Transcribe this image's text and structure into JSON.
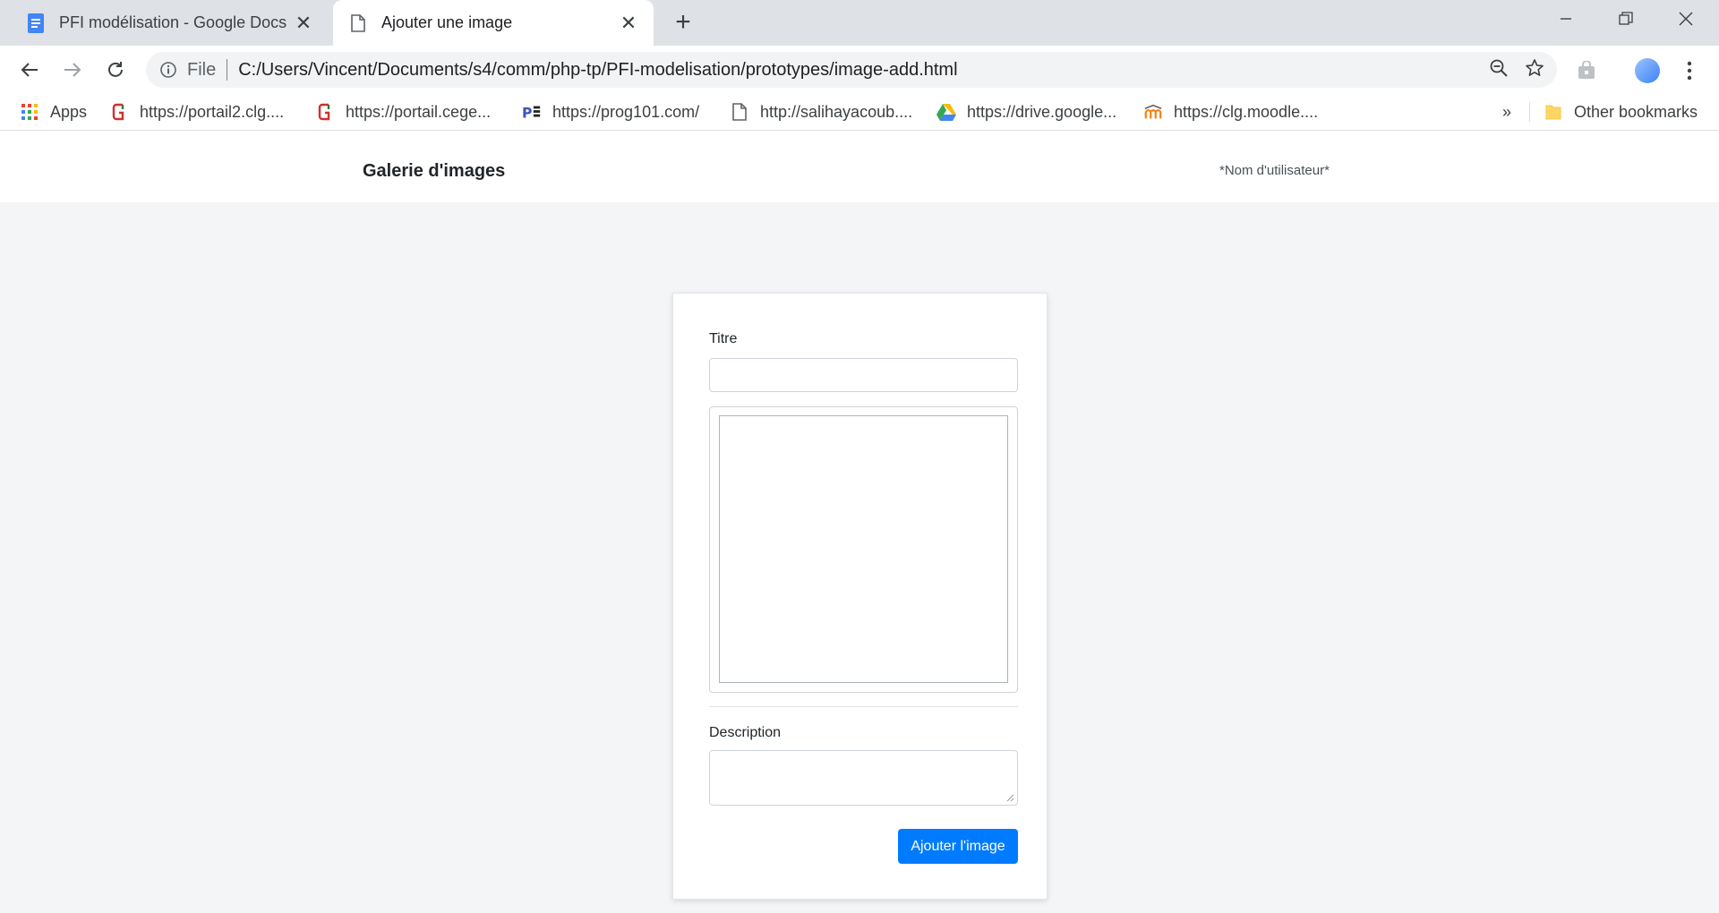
{
  "browser": {
    "tabs": [
      {
        "label": "PFI modélisation - Google Docs",
        "icon": "google-docs-icon"
      },
      {
        "label": "Ajouter une image",
        "icon": "page-icon"
      }
    ],
    "new_tab": "+",
    "omnibox": {
      "scheme": "File",
      "url": "C:/Users/Vincent/Documents/s4/comm/php-tp/PFI-modelisation/prototypes/image-add.html"
    },
    "bookmarks": [
      {
        "label": "Apps",
        "icon": "apps-grid-icon"
      },
      {
        "label": "https://portail2.clg....",
        "icon": "portail-icon"
      },
      {
        "label": "https://portail.cege...",
        "icon": "portail-icon"
      },
      {
        "label": "https://prog101.com/",
        "icon": "prog101-icon"
      },
      {
        "label": "http://salihayacoub....",
        "icon": "page-icon"
      },
      {
        "label": "https://drive.google...",
        "icon": "google-drive-icon"
      },
      {
        "label": "https://clg.moodle....",
        "icon": "moodle-icon"
      }
    ],
    "bookmarks_overflow": "»",
    "other_bookmarks": "Other bookmarks"
  },
  "page": {
    "brand": "Galerie d'images",
    "username": "*Nom d'utilisateur*",
    "form": {
      "title_label": "Titre",
      "title_value": "",
      "description_label": "Description",
      "description_value": "",
      "submit_label": "Ajouter l'image"
    }
  },
  "colors": {
    "primary": "#007bff",
    "page_bg": "#f4f5f7",
    "tabstrip_bg": "#dee1e6"
  }
}
